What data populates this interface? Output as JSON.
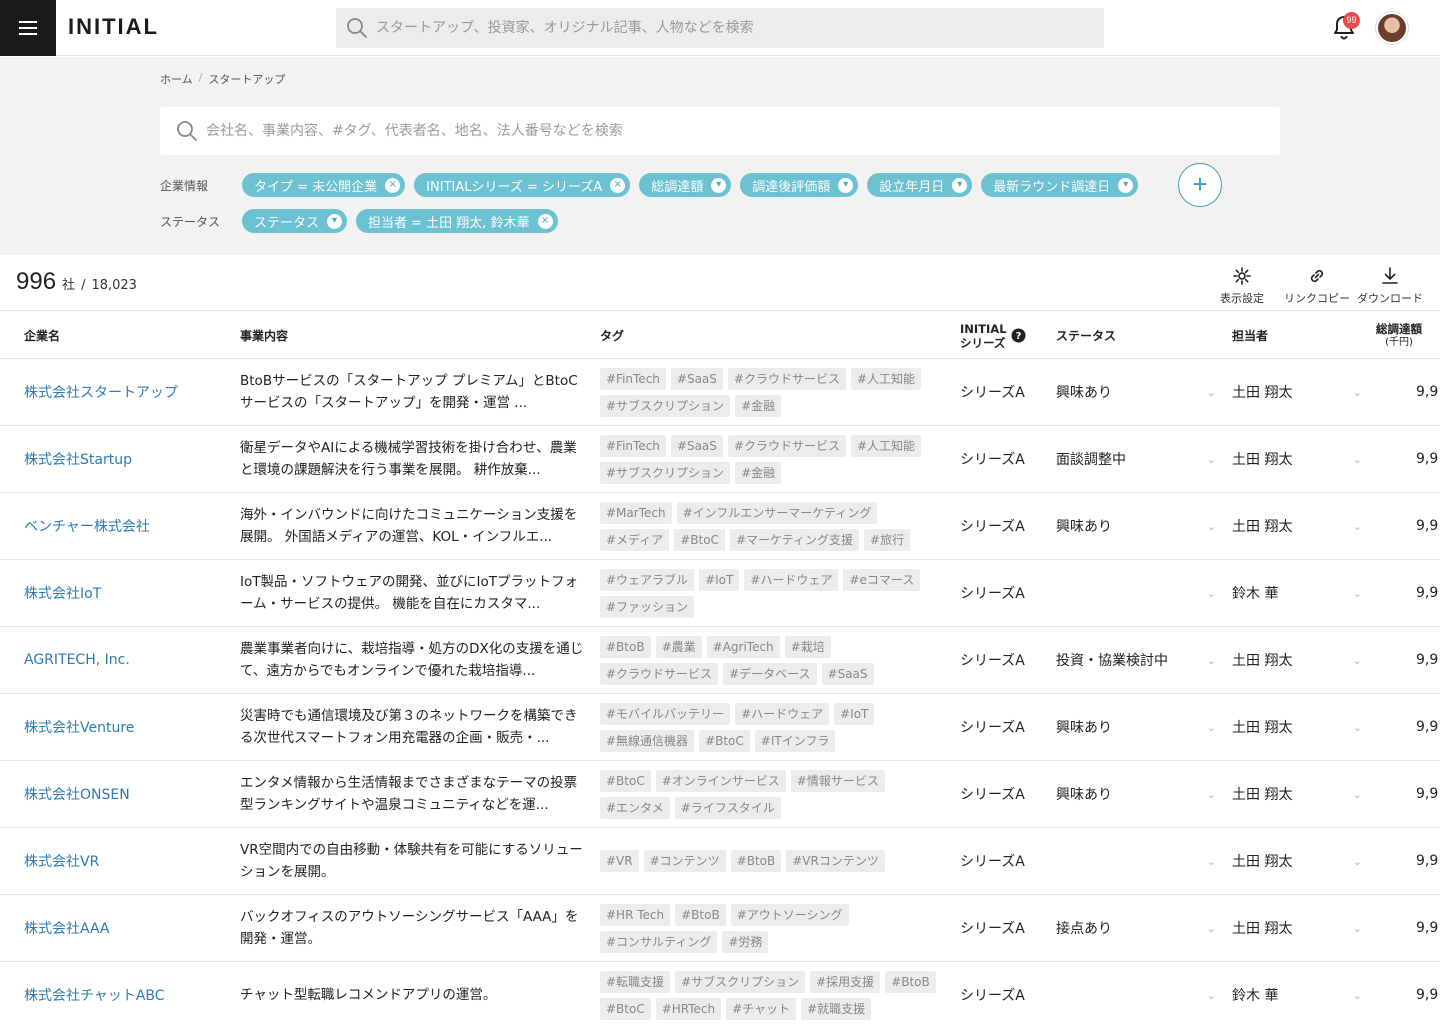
{
  "header": {
    "logo": "INITIAL",
    "search_placeholder": "スタートアップ、投資家、オリジナル記事、人物などを検索",
    "notification_count": "99"
  },
  "breadcrumb": [
    "ホーム",
    "スタートアップ"
  ],
  "company_search_placeholder": "会社名、事業内容、#タグ、代表者名、地名、法人番号などを検索",
  "filters": {
    "company_label": "企業情報",
    "company_chips": [
      {
        "label": "タイプ = 未公開企業",
        "control": "×"
      },
      {
        "label": "INITIALシリーズ = シリーズA",
        "control": "×"
      },
      {
        "label": "総調達額",
        "control": "▾"
      },
      {
        "label": "調達後評価額",
        "control": "▾"
      },
      {
        "label": "設立年月日",
        "control": "▾"
      },
      {
        "label": "最新ラウンド調達日",
        "control": "▾"
      }
    ],
    "status_label": "ステータス",
    "status_chips": [
      {
        "label": "ステータス",
        "control": "▾"
      },
      {
        "label": "担当者 = 土田 翔太, 鈴木華",
        "control": "×"
      }
    ],
    "add_symbol": "+"
  },
  "result": {
    "count": "996",
    "unit": "社",
    "separator": "/",
    "total": "18,023"
  },
  "tools": [
    {
      "icon": "gear-icon",
      "label": "表示設定"
    },
    {
      "icon": "link-icon",
      "label": "リンクコピー"
    },
    {
      "icon": "download-icon",
      "label": "ダウンロード"
    }
  ],
  "columns": {
    "company": "企業名",
    "business": "事業内容",
    "tags": "タグ",
    "series_line1": "INITIAL",
    "series_line2": "シリーズ",
    "status": "ステータス",
    "owner": "担当者",
    "amount_line1": "総調達額",
    "amount_line2": "(千円)"
  },
  "rows": [
    {
      "company": "株式会社スタートアップ",
      "business": "BtoBサービスの「スタートアップ プレミアム」とBtoCサービスの「スタートアップ」を開発・運営 ...",
      "tags": [
        "#FinTech",
        "#SaaS",
        "#クラウドサービス",
        "#人工知能",
        "#サブスクリプション",
        "#金融"
      ],
      "series": "シリーズA",
      "status": "興味あり",
      "owner": "土田 翔太",
      "amount": "9,9"
    },
    {
      "company": "株式会社Startup",
      "business": "衛星データやAIによる機械学習技術を掛け合わせ、農業と環境の課題解決を行う事業を展開。 耕作放棄...",
      "tags": [
        "#FinTech",
        "#SaaS",
        "#クラウドサービス",
        "#人工知能",
        "#サブスクリプション",
        "#金融"
      ],
      "series": "シリーズA",
      "status": "面談調整中",
      "owner": "土田 翔太",
      "amount": "9,9"
    },
    {
      "company": "ベンチャー株式会社",
      "business": "海外・インバウンドに向けたコミュニケーション支援を展開。 外国語メディアの運営、KOL・インフルエ...",
      "tags": [
        "#MarTech",
        "#インフルエンサーマーケティング",
        "#メディア",
        "#BtoC",
        "#マーケティング支援",
        "#旅行"
      ],
      "series": "シリーズA",
      "status": "興味あり",
      "owner": "土田 翔太",
      "amount": "9,9"
    },
    {
      "company": "株式会社IoT",
      "business": "IoT製品・ソフトウェアの開発、並びにIoTプラットフォーム・サービスの提供。 機能を自在にカスタマ...",
      "tags": [
        "#ウェアラブル",
        "#IoT",
        "#ハードウェア",
        "#eコマース",
        "#ファッション"
      ],
      "series": "シリーズA",
      "status": "",
      "owner": "鈴木 華",
      "amount": "9,9"
    },
    {
      "company": "AGRITECH, Inc.",
      "business": "農業事業者向けに、栽培指導・処方のDX化の支援を通じて、遠方からでもオンラインで優れた栽培指導...",
      "tags": [
        "#BtoB",
        "#農業",
        "#AgriTech",
        "#栽培",
        "#クラウドサービス",
        "#データベース",
        "#SaaS"
      ],
      "series": "シリーズA",
      "status": "投資・協業検討中",
      "owner": "土田 翔太",
      "amount": "9,9"
    },
    {
      "company": "株式会社Venture",
      "business": "災害時でも通信環境及び第３のネットワークを構築できる次世代スマートフォン用充電器の企画・販売・...",
      "tags": [
        "#モバイルバッテリー",
        "#ハードウェア",
        "#IoT",
        "#無線通信機器",
        "#BtoC",
        "#ITインフラ"
      ],
      "series": "シリーズA",
      "status": "興味あり",
      "owner": "土田 翔太",
      "amount": "9,9"
    },
    {
      "company": "株式会社ONSEN",
      "business": "エンタメ情報から生活情報までさまざまなテーマの投票型ランキングサイトや温泉コミュニティなどを運...",
      "tags": [
        "#BtoC",
        "#オンラインサービス",
        "#情報サービス",
        "#エンタメ",
        "#ライフスタイル"
      ],
      "series": "シリーズA",
      "status": "興味あり",
      "owner": "土田 翔太",
      "amount": "9,9"
    },
    {
      "company": "株式会社VR",
      "business": "VR空間内での自由移動・体験共有を可能にするソリューションを展開。",
      "tags": [
        "#VR",
        "#コンテンツ",
        "#BtoB",
        "#VRコンテンツ"
      ],
      "series": "シリーズA",
      "status": "",
      "owner": "土田 翔太",
      "amount": "9,9"
    },
    {
      "company": "株式会社AAA",
      "business": "バックオフィスのアウトソーシングサービス「AAA」を開発・運営。",
      "tags": [
        "#HR Tech",
        "#BtoB",
        "#アウトソーシング",
        "#コンサルティング",
        "#労務"
      ],
      "series": "シリーズA",
      "status": "接点あり",
      "owner": "土田 翔太",
      "amount": "9,9"
    },
    {
      "company": "株式会社チャットABC",
      "business": "チャット型転職レコメンドアプリの運営。",
      "tags": [
        "#転職支援",
        "#サブスクリプション",
        "#採用支援",
        "#BtoB",
        "#BtoC",
        "#HRTech",
        "#チャット",
        "#就職支援"
      ],
      "series": "シリーズA",
      "status": "",
      "owner": "鈴木 華",
      "amount": "9,9"
    }
  ]
}
